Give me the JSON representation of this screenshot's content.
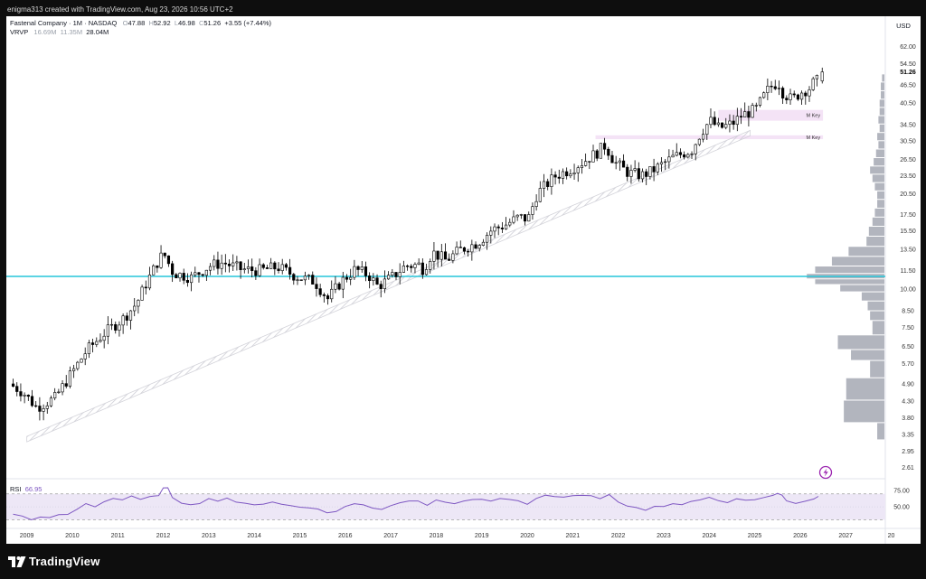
{
  "caption": "enigma313 created with TradingView.com, Aug 23, 2026 10:56 UTC+2",
  "brand": {
    "name": "TradingView"
  },
  "header": {
    "symbol_line": "Fastenal Company · 1M · NASDAQ",
    "o_label": "O",
    "o_value": "47.88",
    "h_label": "H",
    "h_value": "52.92",
    "l_label": "L",
    "l_value": "46.98",
    "c_label": "C",
    "c_value": "51.26",
    "change": "+3.55 (+7.44%)",
    "vrvp_label": "VRVP",
    "vrvp_v1": "16.69M",
    "vrvp_v2": "11.35M",
    "vrvp_v3": "28.04M"
  },
  "price_axis": {
    "currency": "USD",
    "current_price": "51.26",
    "ticks": [
      "62.00",
      "54.50",
      "51.26",
      "46.50",
      "40.50",
      "34.50",
      "30.50",
      "26.50",
      "23.50",
      "20.50",
      "17.50",
      "15.50",
      "13.50",
      "11.50",
      "10.00",
      "8.50",
      "7.50",
      "6.50",
      "5.70",
      "4.90",
      "4.30",
      "3.80",
      "3.35",
      "2.95",
      "2.61"
    ]
  },
  "rsi": {
    "label": "RSI",
    "value": "66.95",
    "ticks": [
      "75.00",
      "50.00"
    ]
  },
  "colors": {
    "candle_up_fill": "#ffffff",
    "candle_down_fill": "#000000",
    "horizontal_line": "#26c6da",
    "zone": "#f3e0f5",
    "profile": "#b2b5be",
    "rsi_line": "#7e57c2",
    "rsi_band": "#ede7f6",
    "lightning": "#9c27b0"
  },
  "chart_data": [
    {
      "type": "candlestick",
      "timeframe": "1M",
      "scale": "log",
      "x_labels": [
        "2009",
        "2010",
        "2011",
        "2012",
        "2013",
        "2014",
        "2015",
        "2016",
        "2017",
        "2018",
        "2019",
        "2020",
        "2021",
        "2022",
        "2023",
        "2024",
        "2025",
        "2026",
        "2027",
        "20"
      ],
      "ylim": [
        2.4,
        68
      ],
      "last_candle": {
        "open": 47.88,
        "high": 52.92,
        "low": 46.98,
        "close": 51.26
      },
      "trend_curve": [
        [
          2008.9,
          4.9
        ],
        [
          2009.2,
          4.6
        ],
        [
          2009.5,
          4.1
        ],
        [
          2009.9,
          4.4
        ],
        [
          2010.3,
          5.4
        ],
        [
          2010.6,
          6.3
        ],
        [
          2011.0,
          7.2
        ],
        [
          2011.4,
          8.0
        ],
        [
          2011.7,
          9.0
        ],
        [
          2011.9,
          10.4
        ],
        [
          2012.2,
          12.6
        ],
        [
          2012.3,
          13.0
        ],
        [
          2012.5,
          11.3
        ],
        [
          2012.9,
          10.9
        ],
        [
          2013.3,
          11.9
        ],
        [
          2013.6,
          12.2
        ],
        [
          2014.0,
          11.6
        ],
        [
          2014.4,
          11.5
        ],
        [
          2014.8,
          11.8
        ],
        [
          2015.2,
          11.0
        ],
        [
          2015.6,
          10.6
        ],
        [
          2015.9,
          9.3
        ],
        [
          2016.2,
          10.6
        ],
        [
          2016.5,
          11.6
        ],
        [
          2016.8,
          11.1
        ],
        [
          2017.0,
          10.2
        ],
        [
          2017.3,
          10.9
        ],
        [
          2017.6,
          11.9
        ],
        [
          2017.9,
          12.0
        ],
        [
          2018.0,
          11.6
        ],
        [
          2018.2,
          13.2
        ],
        [
          2018.5,
          12.4
        ],
        [
          2018.8,
          13.4
        ],
        [
          2019.2,
          14.2
        ],
        [
          2019.5,
          15.6
        ],
        [
          2019.8,
          16.2
        ],
        [
          2020.1,
          17.2
        ],
        [
          2020.3,
          16.9
        ],
        [
          2020.5,
          20.5
        ],
        [
          2020.9,
          23.4
        ],
        [
          2021.2,
          24.5
        ],
        [
          2021.5,
          26.0
        ],
        [
          2021.8,
          27.8
        ],
        [
          2022.0,
          29.5
        ],
        [
          2022.2,
          26.0
        ],
        [
          2022.5,
          24.0
        ],
        [
          2022.8,
          23.5
        ],
        [
          2023.0,
          24.2
        ],
        [
          2023.5,
          27.0
        ],
        [
          2023.9,
          28.5
        ],
        [
          2024.1,
          32.5
        ],
        [
          2024.3,
          35.5
        ],
        [
          2024.5,
          33.5
        ],
        [
          2024.8,
          34.8
        ],
        [
          2025.0,
          37.0
        ],
        [
          2025.3,
          38.5
        ],
        [
          2025.6,
          45.5
        ],
        [
          2025.8,
          47.5
        ],
        [
          2025.9,
          44.0
        ],
        [
          2026.1,
          41.5
        ],
        [
          2026.3,
          44.0
        ],
        [
          2026.5,
          45.5
        ],
        [
          2026.6,
          47.88
        ]
      ],
      "horizontal_line": 11.0,
      "trend_channel": {
        "start": [
          2009.2,
          3.3
        ],
        "end": [
          2025.1,
          33.0
        ]
      },
      "zones": [
        {
          "label": "M Key",
          "top": 38.5,
          "bottom": 35.5,
          "x_start": 2024.4,
          "x_end": 2026.7
        },
        {
          "label": "M Key",
          "top": 31.8,
          "bottom": 30.9,
          "x_start": 2021.7,
          "x_end": 2026.7
        }
      ],
      "volume_profile": [
        {
          "price": 3.35,
          "volume": 0.06
        },
        {
          "price": 4.0,
          "volume": 0.34
        },
        {
          "price": 4.7,
          "volume": 0.32
        },
        {
          "price": 5.6,
          "volume": 0.12
        },
        {
          "price": 6.1,
          "volume": 0.28
        },
        {
          "price": 6.6,
          "volume": 0.39
        },
        {
          "price": 7.6,
          "volume": 0.1
        },
        {
          "price": 8.2,
          "volume": 0.12
        },
        {
          "price": 8.8,
          "volume": 0.14
        },
        {
          "price": 9.5,
          "volume": 0.19
        },
        {
          "price": 10.1,
          "volume": 0.37
        },
        {
          "price": 10.6,
          "volume": 0.58
        },
        {
          "price": 11.0,
          "volume": 0.65
        },
        {
          "price": 11.5,
          "volume": 0.58
        },
        {
          "price": 12.3,
          "volume": 0.44
        },
        {
          "price": 13.3,
          "volume": 0.3
        },
        {
          "price": 14.3,
          "volume": 0.15
        },
        {
          "price": 15.5,
          "volume": 0.13
        },
        {
          "price": 16.6,
          "volume": 0.1
        },
        {
          "price": 17.8,
          "volume": 0.08
        },
        {
          "price": 19.0,
          "volume": 0.06
        },
        {
          "price": 20.3,
          "volume": 0.06
        },
        {
          "price": 21.6,
          "volume": 0.08
        },
        {
          "price": 23.0,
          "volume": 0.1
        },
        {
          "price": 24.5,
          "volume": 0.12
        },
        {
          "price": 26.0,
          "volume": 0.09
        },
        {
          "price": 27.8,
          "volume": 0.07
        },
        {
          "price": 29.6,
          "volume": 0.05
        },
        {
          "price": 31.5,
          "volume": 0.06
        },
        {
          "price": 33.5,
          "volume": 0.04
        },
        {
          "price": 35.8,
          "volume": 0.05
        },
        {
          "price": 38.0,
          "volume": 0.04
        },
        {
          "price": 40.5,
          "volume": 0.04
        },
        {
          "price": 43.0,
          "volume": 0.03
        },
        {
          "price": 46.0,
          "volume": 0.03
        },
        {
          "price": 49.0,
          "volume": 0.02
        }
      ]
    },
    {
      "type": "line",
      "name": "RSI",
      "ylim": [
        18,
        92
      ],
      "bands": [
        70,
        30
      ],
      "points": [
        [
          2008.9,
          40
        ],
        [
          2009.1,
          36
        ],
        [
          2009.3,
          31
        ],
        [
          2009.5,
          34
        ],
        [
          2009.7,
          33
        ],
        [
          2009.9,
          38
        ],
        [
          2010.1,
          37
        ],
        [
          2010.3,
          47
        ],
        [
          2010.5,
          56
        ],
        [
          2010.7,
          50
        ],
        [
          2010.9,
          58
        ],
        [
          2011.1,
          62
        ],
        [
          2011.3,
          60
        ],
        [
          2011.5,
          66
        ],
        [
          2011.7,
          61
        ],
        [
          2011.9,
          67
        ],
        [
          2012.0,
          66
        ],
        [
          2012.1,
          68
        ],
        [
          2012.2,
          78
        ],
        [
          2012.3,
          79
        ],
        [
          2012.4,
          63
        ],
        [
          2012.6,
          55
        ],
        [
          2012.8,
          52
        ],
        [
          2013.0,
          56
        ],
        [
          2013.2,
          62
        ],
        [
          2013.4,
          60
        ],
        [
          2013.6,
          64
        ],
        [
          2013.8,
          57
        ],
        [
          2014.0,
          56
        ],
        [
          2014.2,
          52
        ],
        [
          2014.4,
          54
        ],
        [
          2014.6,
          58
        ],
        [
          2014.8,
          55
        ],
        [
          2015.0,
          53
        ],
        [
          2015.2,
          50
        ],
        [
          2015.4,
          48
        ],
        [
          2015.6,
          46
        ],
        [
          2015.8,
          40
        ],
        [
          2016.0,
          42
        ],
        [
          2016.2,
          50
        ],
        [
          2016.4,
          56
        ],
        [
          2016.6,
          52
        ],
        [
          2016.8,
          48
        ],
        [
          2017.0,
          45
        ],
        [
          2017.2,
          52
        ],
        [
          2017.4,
          56
        ],
        [
          2017.6,
          60
        ],
        [
          2017.8,
          58
        ],
        [
          2018.0,
          53
        ],
        [
          2018.2,
          60
        ],
        [
          2018.4,
          57
        ],
        [
          2018.6,
          56
        ],
        [
          2018.8,
          58
        ],
        [
          2019.0,
          60
        ],
        [
          2019.2,
          62
        ],
        [
          2019.4,
          58
        ],
        [
          2019.6,
          63
        ],
        [
          2019.8,
          61
        ],
        [
          2020.0,
          60
        ],
        [
          2020.2,
          54
        ],
        [
          2020.4,
          64
        ],
        [
          2020.6,
          68
        ],
        [
          2020.8,
          66
        ],
        [
          2021.0,
          65
        ],
        [
          2021.2,
          66
        ],
        [
          2021.4,
          67
        ],
        [
          2021.6,
          66
        ],
        [
          2021.8,
          64
        ],
        [
          2022.0,
          68
        ],
        [
          2022.2,
          56
        ],
        [
          2022.4,
          52
        ],
        [
          2022.6,
          50
        ],
        [
          2022.8,
          46
        ],
        [
          2023.0,
          50
        ],
        [
          2023.2,
          52
        ],
        [
          2023.4,
          55
        ],
        [
          2023.6,
          54
        ],
        [
          2023.8,
          57
        ],
        [
          2024.0,
          60
        ],
        [
          2024.2,
          66
        ],
        [
          2024.4,
          60
        ],
        [
          2024.6,
          57
        ],
        [
          2024.8,
          62
        ],
        [
          2025.0,
          60
        ],
        [
          2025.2,
          61
        ],
        [
          2025.4,
          65
        ],
        [
          2025.6,
          69
        ],
        [
          2025.7,
          70
        ],
        [
          2025.8,
          68
        ],
        [
          2025.9,
          60
        ],
        [
          2026.1,
          55
        ],
        [
          2026.3,
          58
        ],
        [
          2026.5,
          62
        ],
        [
          2026.6,
          67
        ]
      ]
    }
  ]
}
